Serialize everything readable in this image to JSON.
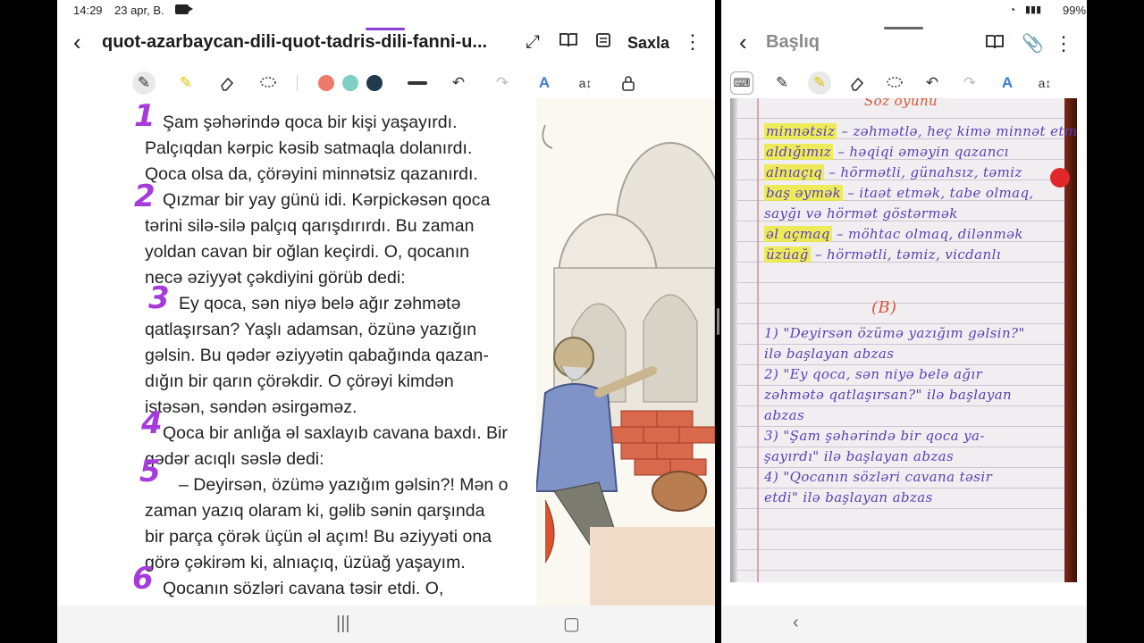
{
  "status": {
    "time": "14:29",
    "date": "23 apr, B.",
    "battery": "99%"
  },
  "left": {
    "title": "quot-azarbaycan-dili-quot-tadris-dili-fanni-u...",
    "save_label": "Saxla",
    "icons": [
      "back-icon",
      "expand-icon",
      "book-view-icon",
      "notes-icon",
      "more-icon"
    ],
    "toolbar": {
      "tools": [
        "pen-icon",
        "highlighter-icon",
        "eraser-icon",
        "lasso-icon"
      ],
      "colors": [
        "#f07a68",
        "#7fcfc4",
        "#1e3a4c"
      ],
      "actions": [
        "stroke-width-icon",
        "undo-icon",
        "redo-icon",
        "text-style-icon",
        "text-fit-icon",
        "lock-icon"
      ]
    },
    "paragraph_markers": [
      "1",
      "2",
      "3",
      "4",
      "5",
      "6"
    ],
    "doc_lines": [
      "Şam şəhərində qoca bir kişi yaşayırdı.",
      "Palçıqdan kərpic kəsib satmaqla dolanırdı.",
      "Qoca olsa da, çörəyini minnətsiz qazanırdı.",
      "Qızmar bir yay günü idi. Kərpickəsən qoca",
      "tərini silə-silə palçıq qarışdırırdı. Bu zaman",
      "yoldan cavan bir oğlan keçirdi. O, qocanın",
      "necə əziyyət çəkdiyini görüb dedi:",
      "Ey qoca, sən niyə belə ağır zəhmətə",
      "qatlaşırsan? Yaşlı adamsan, özünə yazığın",
      "gəlsin. Bu qədər əziyyətin qabağında qazan-",
      "dığın bir qarın çörəkdir. O çörəyi kimdən",
      "istəsən, səndən əsirgəməz.",
      "Qoca bir anlığa əl saxlayıb cavana baxdı. Bir",
      "qədər acıqlı səslə dedi:",
      "– Deyirsən, özümə yazığım gəlsin?! Mən o",
      "zaman yazıq olaram ki, gəlib sənin qarşında",
      "bir parça çörək üçün əl açım! Bu əziyyəti ona",
      "görə çəkirəm ki, alnıaçıq, üzüağ yaşayım.",
      "Qocanın sözləri cavana təsir etdi. O,"
    ]
  },
  "right": {
    "title": "Başlıq",
    "notebook_header": "Söz oyunu",
    "notes": [
      {
        "word": "minnətsiz",
        "text": "– zəhmətlə, heç kimə minnət etmədən"
      },
      {
        "word": "aldığımız",
        "text": "– həqiqi əməyin qazancı"
      },
      {
        "word": "alnıaçıq",
        "text": "– hörmətli, günahsız, təmiz"
      },
      {
        "word": "baş əymək",
        "text": "– itaət etmək, tabe olmaq,"
      },
      {
        "word": "",
        "text": "sayğı və hörmət göstərmək"
      },
      {
        "word": "əl açmaq",
        "text": "– möhtac olmaq, dilənmək"
      },
      {
        "word": "üzüağ",
        "text": "– hörmətli, təmiz, vicdanlı"
      }
    ],
    "section_label": "(B)",
    "tasks": [
      "1) \"Deyirsən özümə yazığım gəlsin?\"",
      "ilə başlayan abzas",
      "2) \"Ey qoca, sən niyə belə ağır",
      "zəhmətə qatlaşırsan?\" ilə başlayan",
      "abzas",
      "3) \"Şam şəhərində bir qoca ya-",
      "şayırdı\" ilə başlayan abzas",
      "4) \"Qocanın sözləri cavana təsir",
      "etdi\" ilə başlayan abzas"
    ]
  }
}
